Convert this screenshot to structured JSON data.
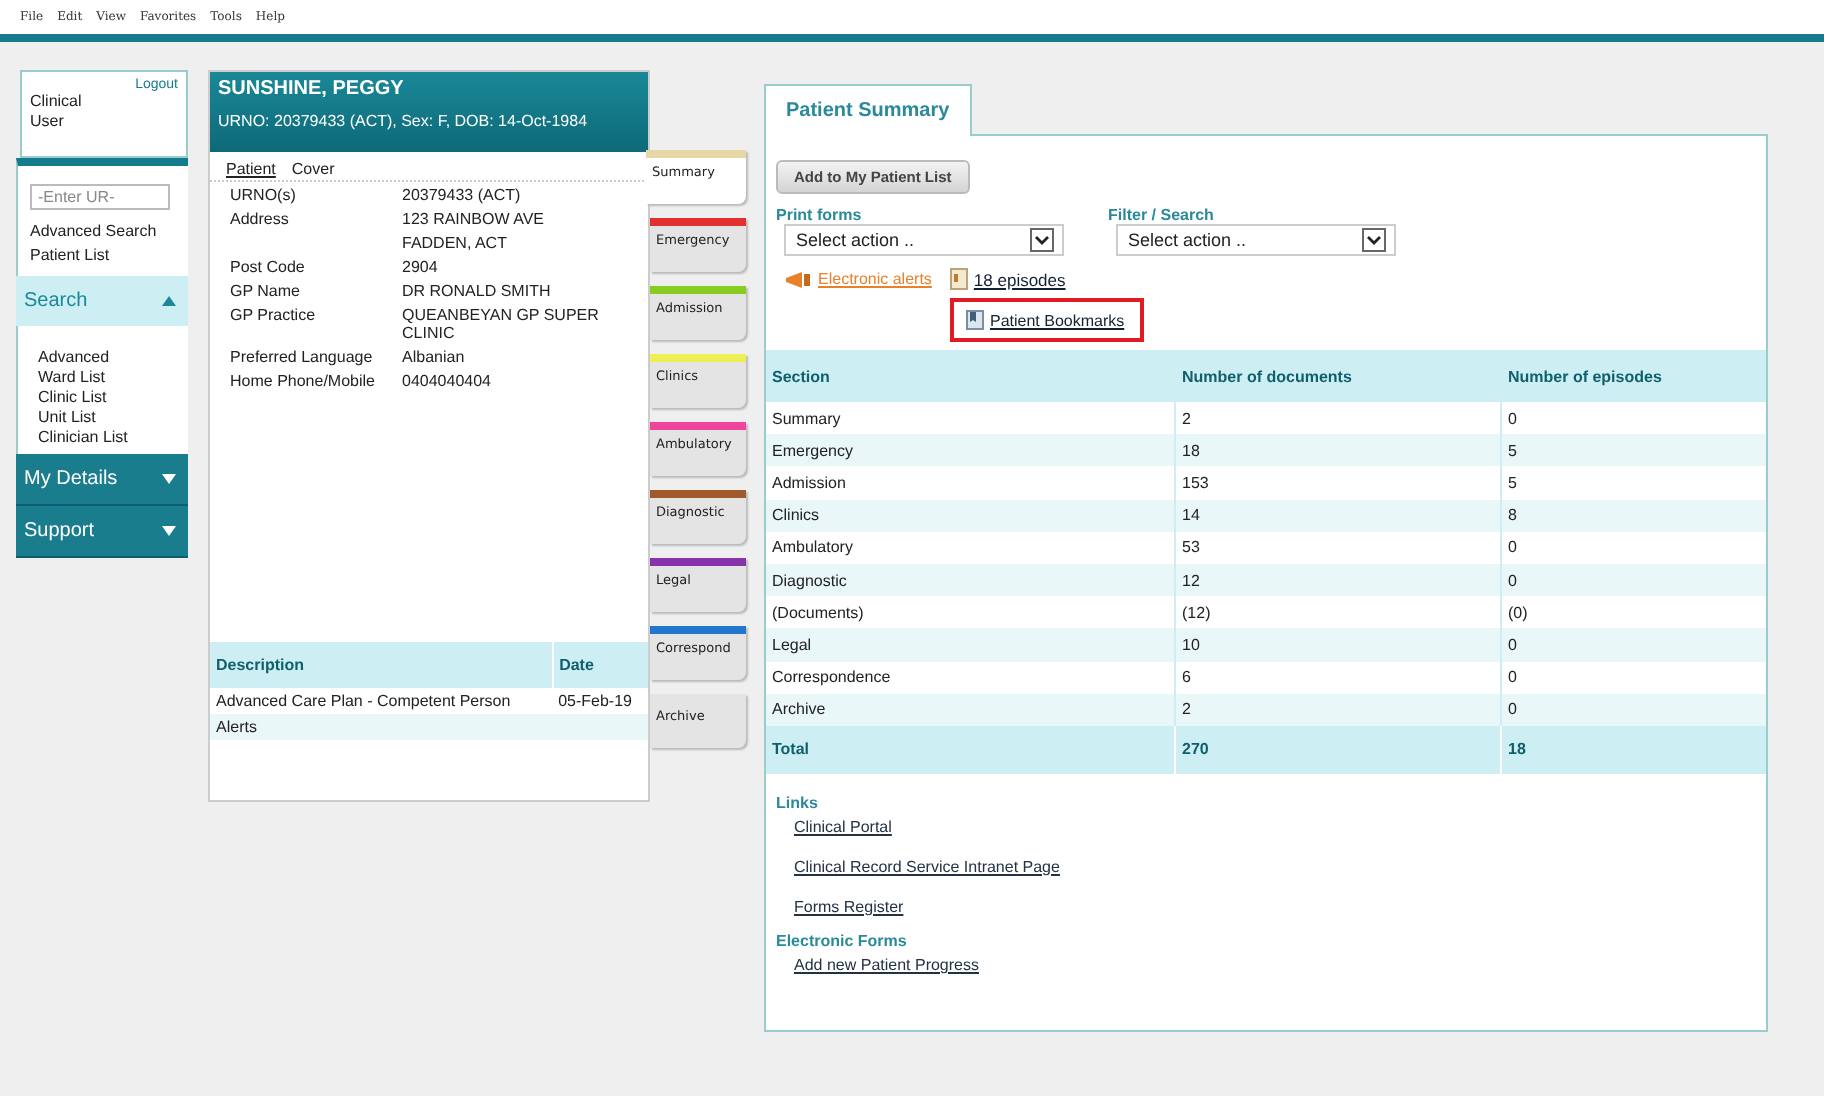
{
  "menu_bar": [
    "File",
    "Edit",
    "View",
    "Favorites",
    "Tools",
    "Help"
  ],
  "sidebar": {
    "logout": "Logout",
    "user": "Clinical User",
    "ur_field": {
      "placeholder": "-Enter UR-"
    },
    "links": [
      "Advanced Search",
      "Patient List"
    ],
    "sections": [
      {
        "title": "Search",
        "expanded": true,
        "items": [
          "Advanced",
          "Ward List",
          "Clinic List",
          "Unit List",
          "Clinician List"
        ]
      },
      {
        "title": "My Details",
        "expanded": false
      },
      {
        "title": "Support",
        "expanded": false
      }
    ]
  },
  "patient": {
    "name": "SUNSHINE, PEGGY",
    "summary": "URNO: 20379433 (ACT), Sex: F, DOB: 14-Oct-1984",
    "tabs": [
      {
        "label": "Patient",
        "selected": true
      },
      {
        "label": "Cover",
        "selected": false
      }
    ],
    "details": [
      {
        "label": "URNO(s)",
        "lines": [
          "20379433 (ACT)"
        ]
      },
      {
        "label": "Address",
        "lines": [
          "123 RAINBOW AVE",
          "FADDEN, ACT"
        ]
      },
      {
        "label": "Post Code",
        "lines": [
          "2904"
        ]
      },
      {
        "label": "GP Name",
        "lines": [
          "DR RONALD SMITH"
        ]
      },
      {
        "label": "GP Practice",
        "lines": [
          "QUEANBEYAN GP SUPER CLINIC"
        ]
      },
      {
        "label": "Preferred Language",
        "lines": [
          "Albanian"
        ]
      },
      {
        "label": "Home Phone/Mobile",
        "lines": [
          "0404040404"
        ]
      }
    ],
    "alerts_table": {
      "columns": [
        "Description",
        "Date"
      ],
      "rows": [
        {
          "description": "Advanced Care Plan - Competent Person",
          "date": "05-Feb-19"
        },
        {
          "description": "Alerts"
        }
      ]
    }
  },
  "section_tabs": [
    {
      "label": "Summary",
      "color": "#e8d8a8",
      "selected": true
    },
    {
      "label": "Emergency",
      "color": "#e03030",
      "selected": false
    },
    {
      "label": "Admission",
      "color": "#88cc22",
      "selected": false
    },
    {
      "label": "Clinics",
      "color": "#eeee55",
      "selected": false
    },
    {
      "label": "Ambulatory",
      "color": "#ee4499",
      "selected": false
    },
    {
      "label": "Diagnostic",
      "color": "#a05a2c",
      "selected": false
    },
    {
      "label": "Legal",
      "color": "#8833aa",
      "selected": false
    },
    {
      "label": "Correspond",
      "color": "#2277cc",
      "selected": false
    },
    {
      "label": "Archive",
      "selected": false
    }
  ],
  "summary": {
    "tabs": [
      {
        "label": "Patient Summary",
        "selected": true
      }
    ],
    "add_button": "Add to My Patient List",
    "dropdowns": [
      {
        "label": "Print forms",
        "value": "Select action .."
      },
      {
        "label": "Filter / Search",
        "value": "Select action .."
      }
    ],
    "alerts_link": "Electronic alerts",
    "episodes_link": "18 episodes",
    "bookmarks_link": {
      "label": "Patient Bookmarks",
      "highlighted": true
    },
    "table": {
      "columns": [
        "Section",
        "Number of documents",
        "Number of episodes"
      ],
      "rows": [
        [
          "Summary",
          "2",
          "0"
        ],
        [
          "Emergency",
          "18",
          "5"
        ],
        [
          "Admission",
          "153",
          "5"
        ],
        [
          "Clinics",
          "14",
          "8"
        ],
        [
          "Ambulatory",
          "53",
          "0"
        ],
        [
          "Diagnostic",
          "12",
          "0"
        ],
        [
          "(Documents)",
          "(12)",
          "(0)"
        ],
        [
          "Legal",
          "10",
          "0"
        ],
        [
          "Correspondence",
          "6",
          "0"
        ],
        [
          "Archive",
          "2",
          "0"
        ]
      ],
      "total": [
        "Total",
        "270",
        "18"
      ]
    },
    "link_groups": [
      {
        "title": "Links",
        "items": [
          "Clinical Portal",
          "Clinical Record Service Intranet Page",
          "Forms Register"
        ]
      },
      {
        "title": "Electronic Forms",
        "items": [
          "Add new Patient Progress"
        ]
      }
    ]
  }
}
